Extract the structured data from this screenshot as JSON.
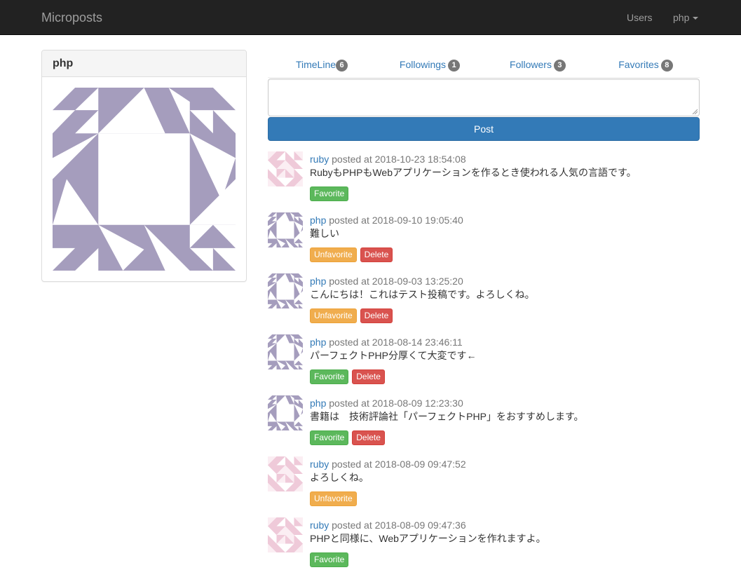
{
  "navbar": {
    "brand": "Microposts",
    "users_link": "Users",
    "current_user": "php"
  },
  "profile": {
    "name": "php"
  },
  "tabs": [
    {
      "label": "TimeLine",
      "count": "6"
    },
    {
      "label": "Followings",
      "count": "1"
    },
    {
      "label": "Followers",
      "count": "3"
    },
    {
      "label": "Favorites",
      "count": "8"
    }
  ],
  "composer": {
    "post_label": "Post"
  },
  "feed": [
    {
      "user": "ruby",
      "posted": "posted at 2018-10-23 18:54:08",
      "text": "RubyもPHPもWebアプリケーションを作るとき使われる人気の言語です。",
      "fav": "Favorite",
      "del": ""
    },
    {
      "user": "php",
      "posted": "posted at 2018-09-10 19:05:40",
      "text": "難しい",
      "fav": "Unfavorite",
      "del": "Delete"
    },
    {
      "user": "php",
      "posted": "posted at 2018-09-03 13:25:20",
      "text": "こんにちは！これはテスト投稿です。よろしくね。",
      "fav": "Unfavorite",
      "del": "Delete"
    },
    {
      "user": "php",
      "posted": "posted at 2018-08-14 23:46:11",
      "text": "パーフェクトPHP分厚くて大変です←",
      "fav": "Favorite",
      "del": "Delete"
    },
    {
      "user": "php",
      "posted": "posted at 2018-08-09 12:23:30",
      "text": "書籍は　技術評論社「パーフェクトPHP」をおすすめします。",
      "fav": "Favorite",
      "del": "Delete"
    },
    {
      "user": "ruby",
      "posted": "posted at 2018-08-09 09:47:52",
      "text": "よろしくね。",
      "fav": "Unfavorite",
      "del": ""
    },
    {
      "user": "ruby",
      "posted": "posted at 2018-08-09 09:47:36",
      "text": "PHPと同様に、Webアプリケーションを作れますよ。",
      "fav": "Favorite",
      "del": ""
    }
  ],
  "colors": {
    "navbar_bg": "#222222",
    "link": "#337ab7",
    "primary": "#337ab7",
    "success": "#5cb85c",
    "warning": "#f0ad4e",
    "danger": "#d9534f",
    "php_identicon": "#a59dbd",
    "ruby_identicon": "#efcad9"
  }
}
